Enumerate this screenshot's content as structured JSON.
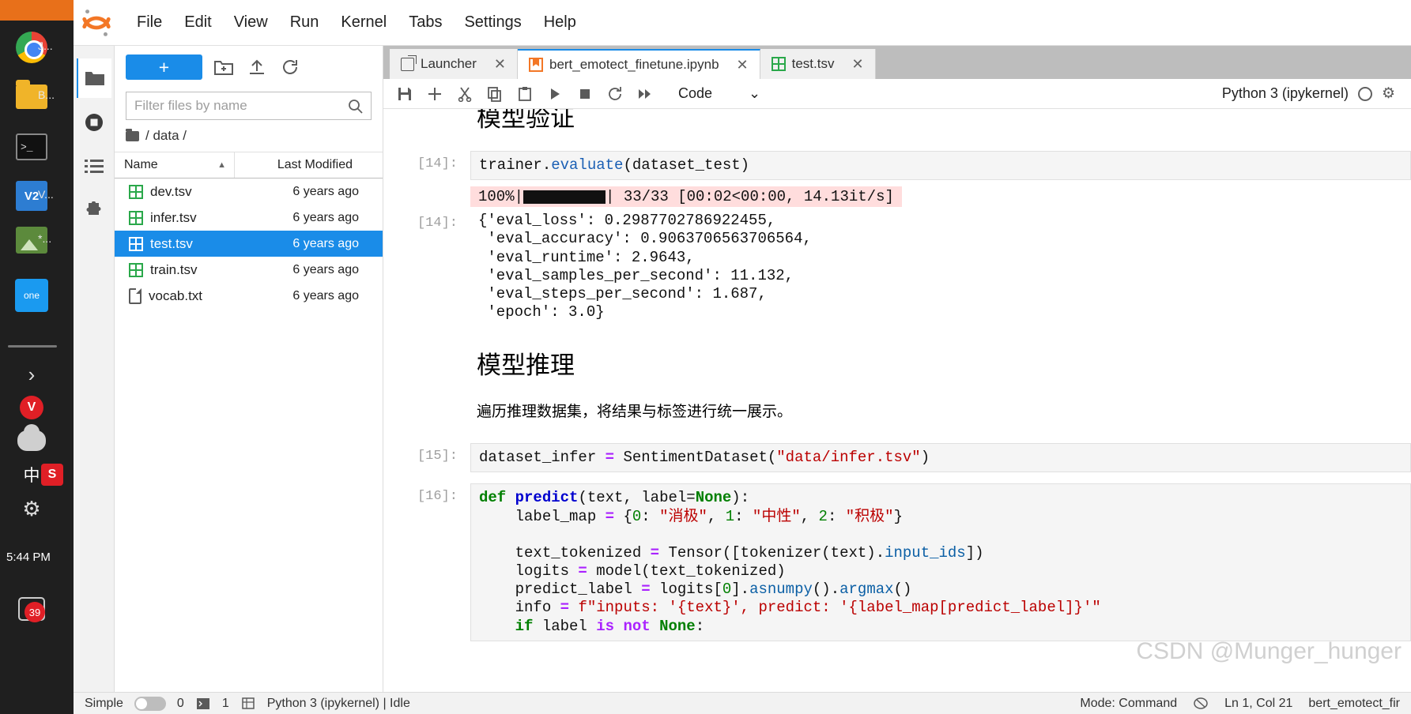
{
  "taskbar": {
    "items": [
      {
        "name": "chrome",
        "label": "J..."
      },
      {
        "name": "folder",
        "label": "B..."
      },
      {
        "name": "terminal",
        "label": ""
      },
      {
        "name": "vscode",
        "label": "V..."
      },
      {
        "name": "picture",
        "label": "*..."
      },
      {
        "name": "onenote",
        "label": ""
      },
      {
        "name": "chevron",
        "label": ""
      },
      {
        "name": "v-app",
        "label": ""
      },
      {
        "name": "cloud",
        "label": ""
      },
      {
        "name": "ime-cn",
        "label": "中"
      },
      {
        "name": "s-app",
        "label": ""
      },
      {
        "name": "settings",
        "label": ""
      }
    ],
    "vs_label": "V2",
    "one_label": "one",
    "cn_label": "中",
    "s_label": "S",
    "clock": "5:44 PM",
    "message_badge": "39"
  },
  "menubar": {
    "items": [
      "File",
      "Edit",
      "View",
      "Run",
      "Kernel",
      "Tabs",
      "Settings",
      "Help"
    ]
  },
  "filebrowser": {
    "new_launcher_label": "+",
    "toolbar_icons": [
      "new-folder-icon",
      "upload-icon",
      "refresh-icon"
    ],
    "filter_placeholder": "Filter files by name",
    "filter_value": "",
    "breadcrumb": "/ data /",
    "columns": {
      "name": "Name",
      "last_modified": "Last Modified"
    },
    "files": [
      {
        "name": "dev.tsv",
        "modified": "6 years ago",
        "icon": "tsv-icon",
        "selected": false
      },
      {
        "name": "infer.tsv",
        "modified": "6 years ago",
        "icon": "tsv-icon",
        "selected": false
      },
      {
        "name": "test.tsv",
        "modified": "6 years ago",
        "icon": "tsv-icon",
        "selected": true
      },
      {
        "name": "train.tsv",
        "modified": "6 years ago",
        "icon": "tsv-icon",
        "selected": false
      },
      {
        "name": "vocab.txt",
        "modified": "6 years ago",
        "icon": "text-file-icon",
        "selected": false
      }
    ]
  },
  "tabs": [
    {
      "label": "Launcher",
      "icon": "launcher-icon",
      "active": false,
      "close": "✕"
    },
    {
      "label": "bert_emotect_finetune.ipynb",
      "icon": "notebook-icon",
      "active": true,
      "close": "✕"
    },
    {
      "label": "test.tsv",
      "icon": "tsv-icon",
      "active": false,
      "close": "✕"
    }
  ],
  "notebook_toolbar": {
    "cell_type": "Code",
    "kernel_name": "Python 3 (ipykernel)",
    "buttons": [
      "save-icon",
      "add-cell-icon",
      "cut-icon",
      "copy-icon",
      "paste-icon",
      "run-icon",
      "stop-icon",
      "restart-icon",
      "restart-run-all-icon"
    ]
  },
  "notebook": {
    "heading_validation": "模型验证",
    "heading_inference": "模型推理",
    "inference_para": "遍历推理数据集，将结果与标签进行统一展示。",
    "cell14_prompt": "[14]:",
    "cell14_out_prompt": "[14]:",
    "cell15_prompt": "[15]:",
    "cell16_prompt": "[16]:",
    "cell14_code_a": "trainer.",
    "cell14_code_b": "evaluate",
    "cell14_code_c": "(dataset_test)",
    "progress": {
      "percent": "100%|",
      "bar": "████████████",
      "stats": "| 33/33 [00:02<00:00, 14.13it/s]"
    },
    "eval_output": [
      "{'eval_loss': 0.2987702786922455,",
      " 'eval_accuracy': 0.9063706563706564,",
      " 'eval_runtime': 2.9643,",
      " 'eval_samples_per_second': 11.132,",
      " 'eval_steps_per_second': 1.687,",
      " 'epoch': 3.0}"
    ],
    "cell15_code": {
      "var": "dataset_infer ",
      "eq": "=",
      "call": " SentimentDataset(",
      "str": "\"data/infer.tsv\"",
      "end": ")"
    },
    "cell16_lines": [
      "def predict(text, label=None):",
      "    label_map = {0: \"消极\", 1: \"中性\", 2: \"积极\"}",
      "",
      "    text_tokenized = Tensor([tokenizer(text).input_ids])",
      "    logits = model(text_tokenized)",
      "    predict_label = logits[0].asnumpy().argmax()",
      "    info = f\"inputs: '{text}', predict: '{label_map[predict_label]}'\"",
      "    if label is not None:"
    ]
  },
  "statusbar": {
    "simple_label": "Simple",
    "count_zero": "0",
    "count_one": "1",
    "kernel_status": "Python 3 (ipykernel) | Idle",
    "mode": "Mode: Command",
    "position": "Ln 1, Col 21",
    "filename": "bert_emotect_fir"
  },
  "watermark": "CSDN @Munger_hunger",
  "colors": {
    "accent": "#1a8ce8",
    "jupyter_orange": "#f37726",
    "tsv_green": "#2aa84a",
    "progress_bg": "#ffdddd"
  }
}
